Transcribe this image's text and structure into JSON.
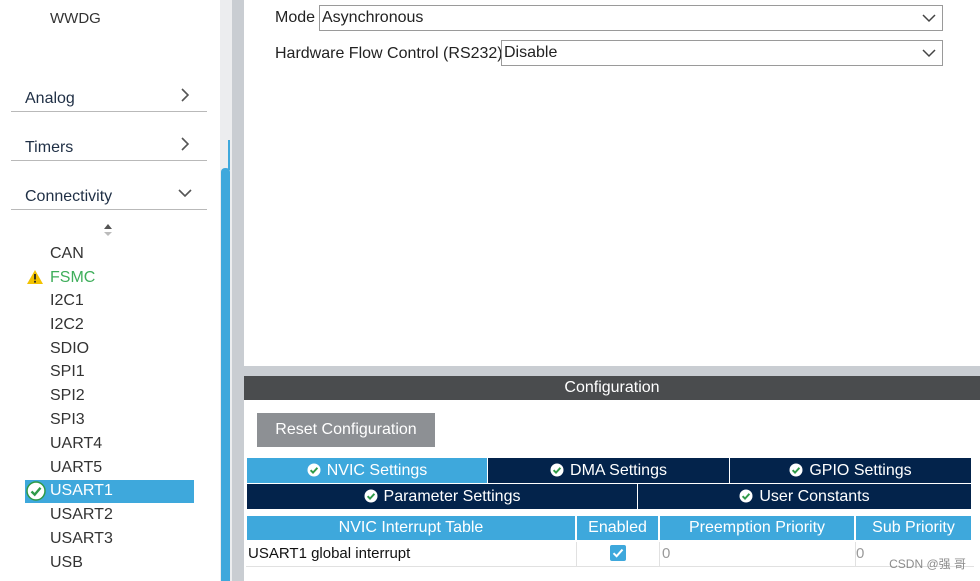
{
  "sidebar": {
    "top_item": "WWDG",
    "categories": [
      {
        "label": "Analog",
        "state": "collapsed"
      },
      {
        "label": "Timers",
        "state": "collapsed"
      },
      {
        "label": "Connectivity",
        "state": "expanded"
      }
    ],
    "peripherals": [
      "CAN",
      "FSMC",
      "I2C1",
      "I2C2",
      "SDIO",
      "SPI1",
      "SPI2",
      "SPI3",
      "UART4",
      "UART5",
      "USART1",
      "USART2",
      "USART3",
      "USB"
    ],
    "warning_item": "FSMC",
    "selected_item": "USART1"
  },
  "mode": {
    "mode_label": "Mode",
    "mode_value": "Asynchronous",
    "flow_label": "Hardware Flow Control (RS232)",
    "flow_value": "Disable"
  },
  "config": {
    "header": "Configuration",
    "reset_button": "Reset Configuration",
    "tabs_row1": [
      "NVIC Settings",
      "DMA Settings",
      "GPIO Settings"
    ],
    "tabs_row2": [
      "Parameter Settings",
      "User Constants"
    ],
    "active_tab": "NVIC Settings",
    "table": {
      "columns": [
        "NVIC Interrupt Table",
        "Enabled",
        "Preemption Priority",
        "Sub Priority"
      ],
      "rows": [
        {
          "name": "USART1 global interrupt",
          "enabled": true,
          "preemption": "0",
          "sub": "0"
        }
      ]
    }
  },
  "watermark": "CSDN @强 哥",
  "colors": {
    "accent": "#3ea8dc",
    "navy": "#03234b",
    "warning_text": "#3fae5b",
    "header_bg": "#4a4c4e",
    "button_bg": "#8d9094"
  }
}
